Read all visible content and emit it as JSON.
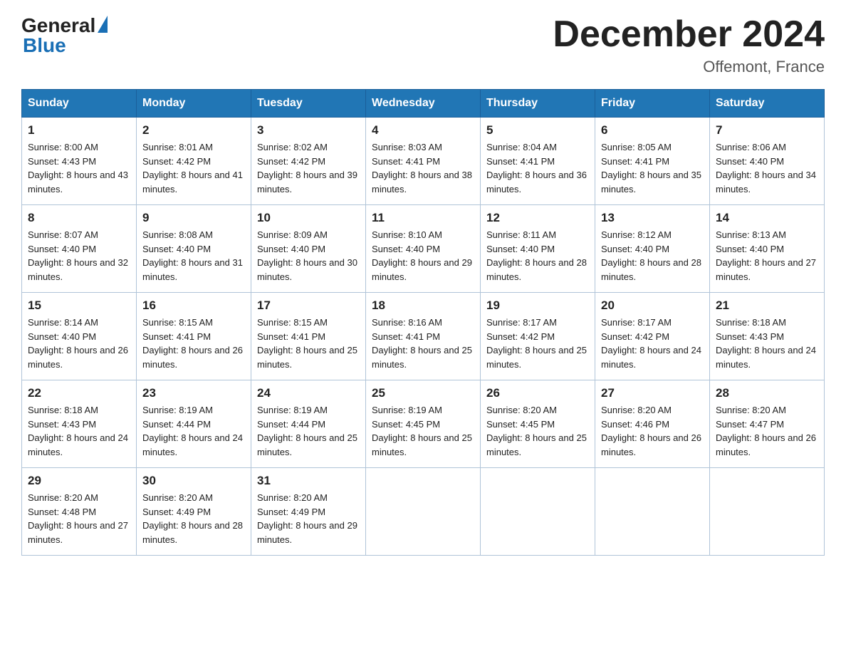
{
  "logo": {
    "line1": "General",
    "triangle": "▶",
    "line2": "Blue"
  },
  "title": "December 2024",
  "location": "Offemont, France",
  "days_header": [
    "Sunday",
    "Monday",
    "Tuesday",
    "Wednesday",
    "Thursday",
    "Friday",
    "Saturday"
  ],
  "weeks": [
    [
      {
        "num": "1",
        "sunrise": "8:00 AM",
        "sunset": "4:43 PM",
        "daylight": "8 hours and 43 minutes."
      },
      {
        "num": "2",
        "sunrise": "8:01 AM",
        "sunset": "4:42 PM",
        "daylight": "8 hours and 41 minutes."
      },
      {
        "num": "3",
        "sunrise": "8:02 AM",
        "sunset": "4:42 PM",
        "daylight": "8 hours and 39 minutes."
      },
      {
        "num": "4",
        "sunrise": "8:03 AM",
        "sunset": "4:41 PM",
        "daylight": "8 hours and 38 minutes."
      },
      {
        "num": "5",
        "sunrise": "8:04 AM",
        "sunset": "4:41 PM",
        "daylight": "8 hours and 36 minutes."
      },
      {
        "num": "6",
        "sunrise": "8:05 AM",
        "sunset": "4:41 PM",
        "daylight": "8 hours and 35 minutes."
      },
      {
        "num": "7",
        "sunrise": "8:06 AM",
        "sunset": "4:40 PM",
        "daylight": "8 hours and 34 minutes."
      }
    ],
    [
      {
        "num": "8",
        "sunrise": "8:07 AM",
        "sunset": "4:40 PM",
        "daylight": "8 hours and 32 minutes."
      },
      {
        "num": "9",
        "sunrise": "8:08 AM",
        "sunset": "4:40 PM",
        "daylight": "8 hours and 31 minutes."
      },
      {
        "num": "10",
        "sunrise": "8:09 AM",
        "sunset": "4:40 PM",
        "daylight": "8 hours and 30 minutes."
      },
      {
        "num": "11",
        "sunrise": "8:10 AM",
        "sunset": "4:40 PM",
        "daylight": "8 hours and 29 minutes."
      },
      {
        "num": "12",
        "sunrise": "8:11 AM",
        "sunset": "4:40 PM",
        "daylight": "8 hours and 28 minutes."
      },
      {
        "num": "13",
        "sunrise": "8:12 AM",
        "sunset": "4:40 PM",
        "daylight": "8 hours and 28 minutes."
      },
      {
        "num": "14",
        "sunrise": "8:13 AM",
        "sunset": "4:40 PM",
        "daylight": "8 hours and 27 minutes."
      }
    ],
    [
      {
        "num": "15",
        "sunrise": "8:14 AM",
        "sunset": "4:40 PM",
        "daylight": "8 hours and 26 minutes."
      },
      {
        "num": "16",
        "sunrise": "8:15 AM",
        "sunset": "4:41 PM",
        "daylight": "8 hours and 26 minutes."
      },
      {
        "num": "17",
        "sunrise": "8:15 AM",
        "sunset": "4:41 PM",
        "daylight": "8 hours and 25 minutes."
      },
      {
        "num": "18",
        "sunrise": "8:16 AM",
        "sunset": "4:41 PM",
        "daylight": "8 hours and 25 minutes."
      },
      {
        "num": "19",
        "sunrise": "8:17 AM",
        "sunset": "4:42 PM",
        "daylight": "8 hours and 25 minutes."
      },
      {
        "num": "20",
        "sunrise": "8:17 AM",
        "sunset": "4:42 PM",
        "daylight": "8 hours and 24 minutes."
      },
      {
        "num": "21",
        "sunrise": "8:18 AM",
        "sunset": "4:43 PM",
        "daylight": "8 hours and 24 minutes."
      }
    ],
    [
      {
        "num": "22",
        "sunrise": "8:18 AM",
        "sunset": "4:43 PM",
        "daylight": "8 hours and 24 minutes."
      },
      {
        "num": "23",
        "sunrise": "8:19 AM",
        "sunset": "4:44 PM",
        "daylight": "8 hours and 24 minutes."
      },
      {
        "num": "24",
        "sunrise": "8:19 AM",
        "sunset": "4:44 PM",
        "daylight": "8 hours and 25 minutes."
      },
      {
        "num": "25",
        "sunrise": "8:19 AM",
        "sunset": "4:45 PM",
        "daylight": "8 hours and 25 minutes."
      },
      {
        "num": "26",
        "sunrise": "8:20 AM",
        "sunset": "4:45 PM",
        "daylight": "8 hours and 25 minutes."
      },
      {
        "num": "27",
        "sunrise": "8:20 AM",
        "sunset": "4:46 PM",
        "daylight": "8 hours and 26 minutes."
      },
      {
        "num": "28",
        "sunrise": "8:20 AM",
        "sunset": "4:47 PM",
        "daylight": "8 hours and 26 minutes."
      }
    ],
    [
      {
        "num": "29",
        "sunrise": "8:20 AM",
        "sunset": "4:48 PM",
        "daylight": "8 hours and 27 minutes."
      },
      {
        "num": "30",
        "sunrise": "8:20 AM",
        "sunset": "4:49 PM",
        "daylight": "8 hours and 28 minutes."
      },
      {
        "num": "31",
        "sunrise": "8:20 AM",
        "sunset": "4:49 PM",
        "daylight": "8 hours and 29 minutes."
      },
      null,
      null,
      null,
      null
    ]
  ]
}
